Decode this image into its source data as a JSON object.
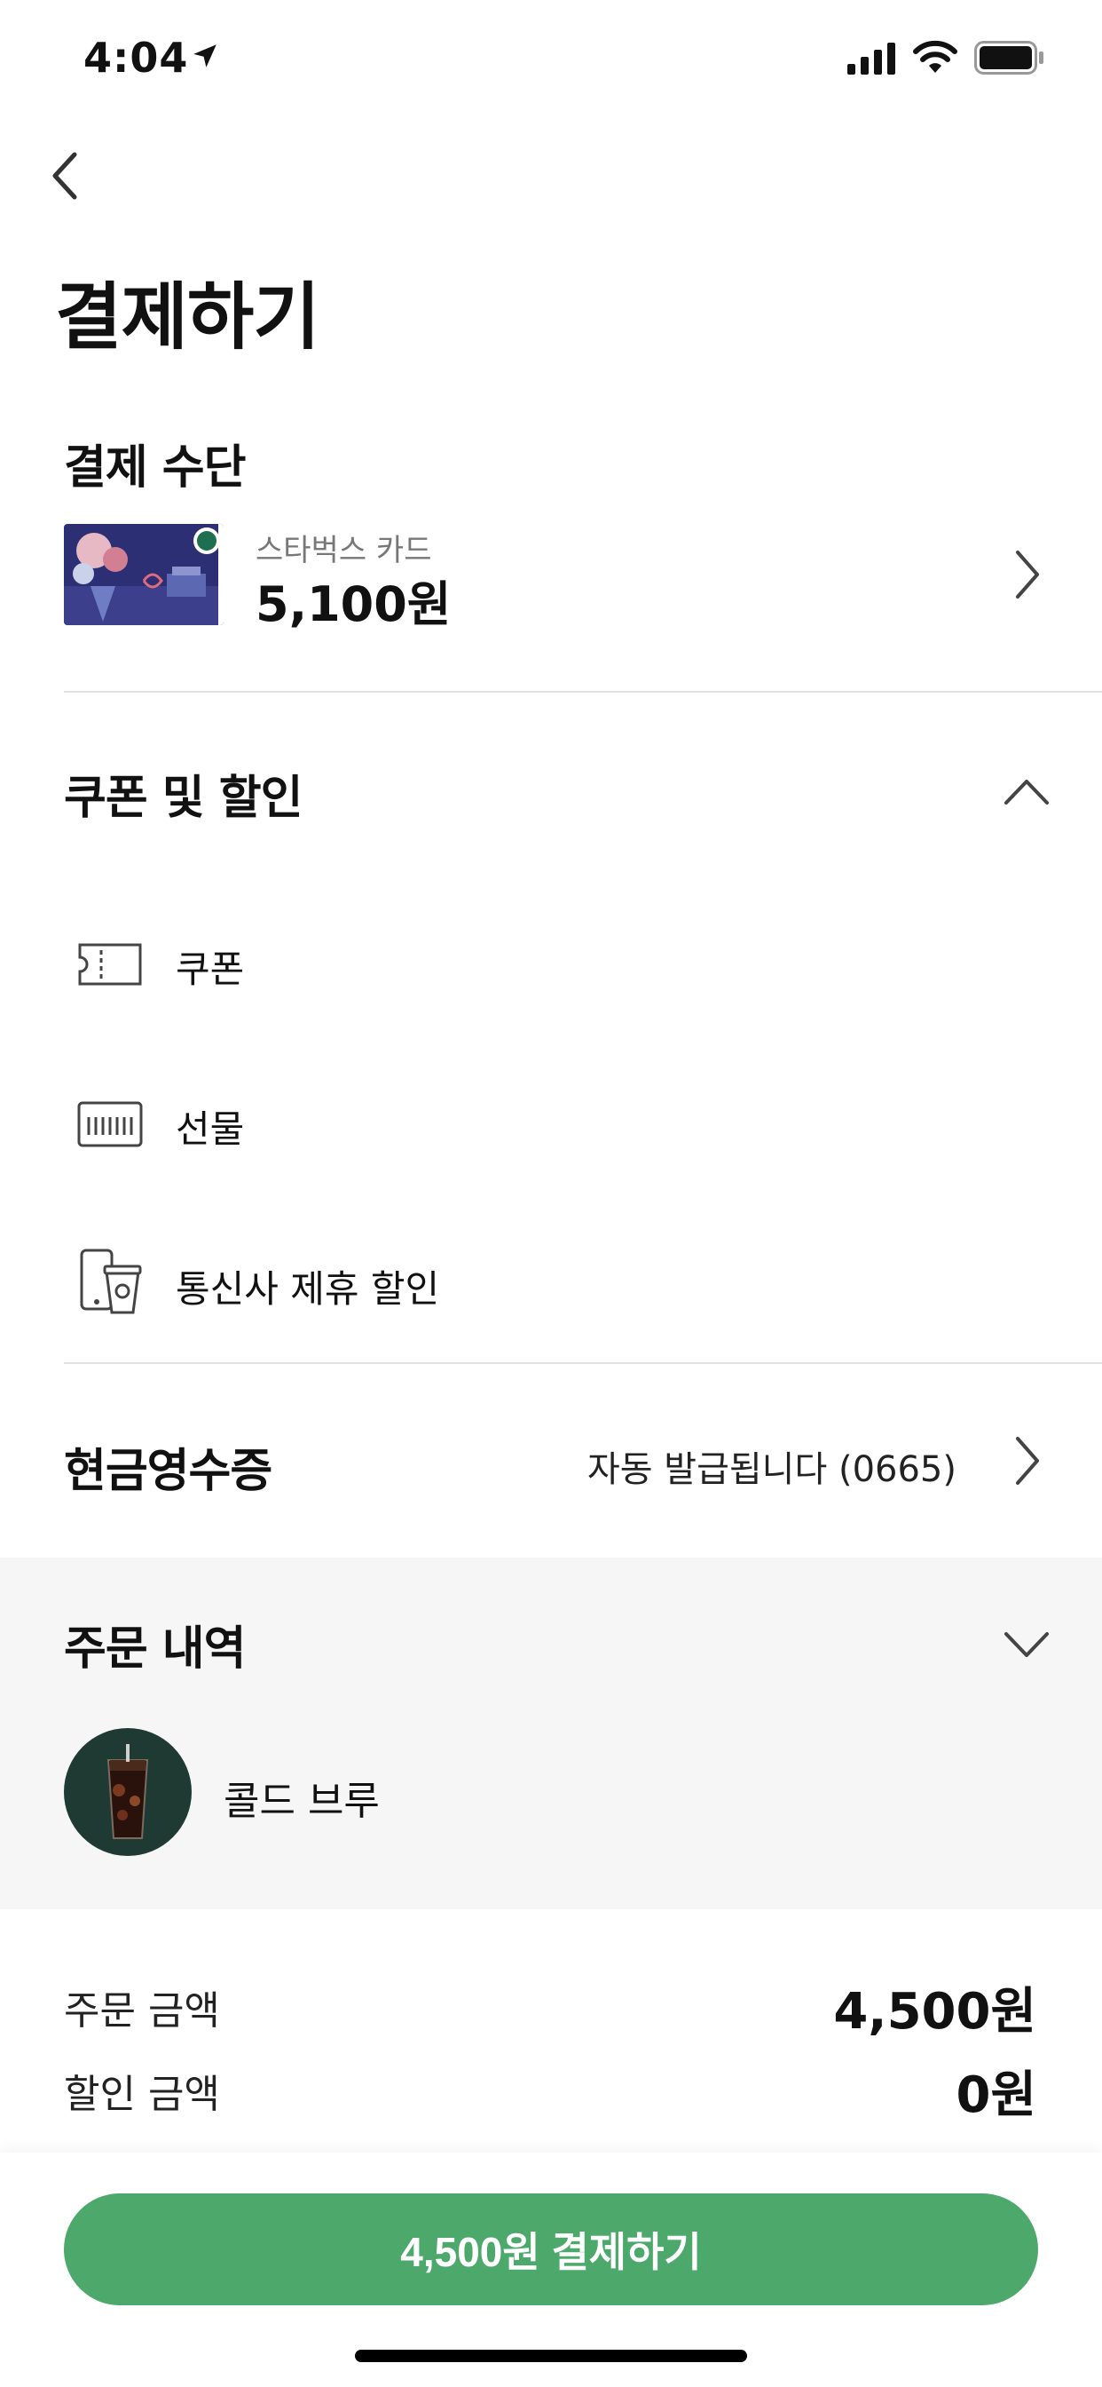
{
  "status_bar": {
    "time": "4:04",
    "icons": [
      "location-arrow-icon",
      "cellular-signal-icon",
      "wifi-icon",
      "battery-icon"
    ]
  },
  "header": {
    "back_icon": "chevron-left-icon",
    "title": "결제하기"
  },
  "payment_method": {
    "title": "결제 수단",
    "card_label": "스타벅스 카드",
    "card_balance": "5,100원",
    "chevron_icon": "chevron-right-icon"
  },
  "discounts": {
    "title": "쿠폰 및 할인",
    "toggle_icon": "chevron-up-icon",
    "items": [
      {
        "icon": "ticket-icon",
        "label": "쿠폰"
      },
      {
        "icon": "gift-card-icon",
        "label": "선물"
      },
      {
        "icon": "phone-cup-icon",
        "label": "통신사 제휴 할인"
      }
    ]
  },
  "cash_receipt": {
    "title": "현금영수증",
    "value": "자동 발급됩니다 (0665)",
    "chevron_icon": "chevron-right-icon"
  },
  "order": {
    "title": "주문 내역",
    "toggle_icon": "chevron-down-icon",
    "items": [
      {
        "name": "콜드 브루",
        "image": "cold-brew-drink"
      }
    ]
  },
  "summary": {
    "order_amount_label": "주문 금액",
    "order_amount_value": "4,500원",
    "discount_amount_label": "할인 금액",
    "discount_amount_value": "0원"
  },
  "pay_button": {
    "label": "4,500원 결제하기"
  },
  "colors": {
    "accent_green": "#4ca96b",
    "panel_background": "#f6f6f6",
    "divider": "#e2e2e2"
  }
}
